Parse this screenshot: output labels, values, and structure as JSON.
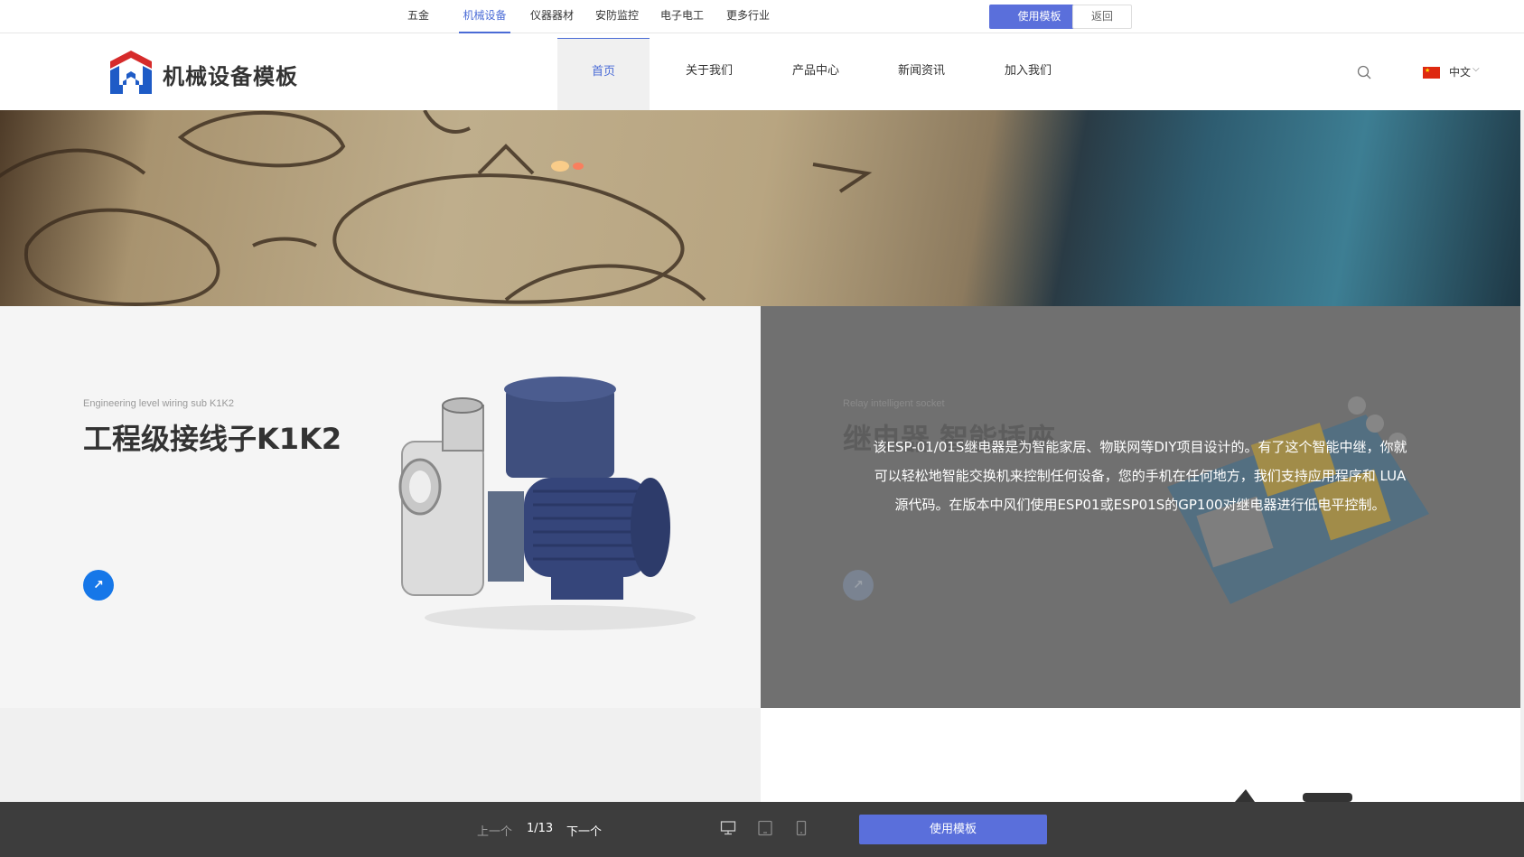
{
  "topbar": {
    "industries": [
      "五金",
      "机械设备",
      "仪器器材",
      "安防监控",
      "电子电工",
      "更多行业"
    ],
    "active_industry": "机械设备",
    "use_template_label": "使用模板",
    "back_label": "返回"
  },
  "header": {
    "logo_text": "机械设备模板",
    "nav": [
      "首页",
      "关于我们",
      "产品中心",
      "新闻资讯",
      "加入我们"
    ],
    "active_nav": "首页",
    "language": "中文"
  },
  "products": [
    {
      "subtitle": "Engineering level wiring sub K1K2",
      "title": "工程级接线子K1K2"
    },
    {
      "subtitle": "Relay intelligent socket",
      "title": "继电器 智能插座",
      "description": "该ESP-01/01S继电器是为智能家居、物联网等DIY项目设计的。有了这个智能中继，你就可以轻松地智能交换机来控制任何设备，您的手机在任何地方，我们支持应用程序和 LUA源代码。在版本中风们使用ESP01或ESP01S的GP100对继电器进行低电平控制。"
    }
  ],
  "bottombar": {
    "prev_label": "上一个",
    "counter": "1/13",
    "next_label": "下一个",
    "use_template_label": "使用模板"
  },
  "colors": {
    "accent": "#5a6fdb",
    "nav_active": "#4a6bd6",
    "arrow_button": "#1677e8",
    "logo_red": "#d62b2b",
    "logo_blue": "#1e5bc6"
  },
  "icons": [
    "search-icon",
    "flag-cn-icon",
    "chevron-down-icon",
    "arrow-up-right-icon",
    "desktop-icon",
    "tablet-icon",
    "mobile-icon"
  ]
}
